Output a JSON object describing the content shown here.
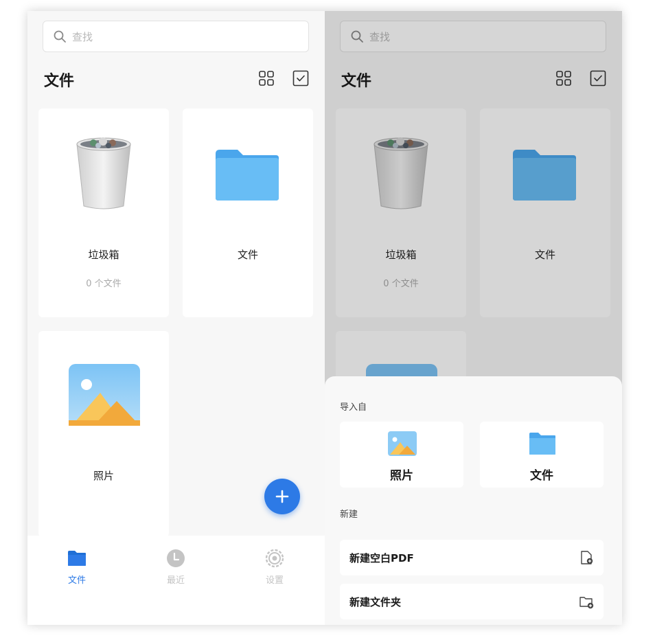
{
  "search": {
    "placeholder": "查找"
  },
  "header": {
    "title": "文件"
  },
  "cards": {
    "trash": {
      "label": "垃圾箱",
      "count": "0 个文件"
    },
    "files": {
      "label": "文件"
    },
    "photos": {
      "label": "照片"
    }
  },
  "tabbar": {
    "files": "文件",
    "recent": "最近",
    "settings": "设置"
  },
  "sheet": {
    "import_title": "导入自",
    "import_photos": "照片",
    "import_files": "文件",
    "new_title": "新建",
    "new_pdf": "新建空白PDF",
    "new_folder": "新建文件夹"
  },
  "icons": {
    "search": "search-icon",
    "grid": "grid-view-icon",
    "select": "select-checkbox-icon",
    "trash": "trash-bin-icon",
    "folder": "folder-icon",
    "photo": "photo-icon",
    "add": "plus-icon",
    "recent": "clock-icon",
    "settings": "gear-icon",
    "new_file": "add-file-icon",
    "new_folder": "add-folder-icon"
  },
  "colors": {
    "accent": "#2d7ae6",
    "folder": "#5fb3f0",
    "inactive": "#c4c4c4"
  }
}
